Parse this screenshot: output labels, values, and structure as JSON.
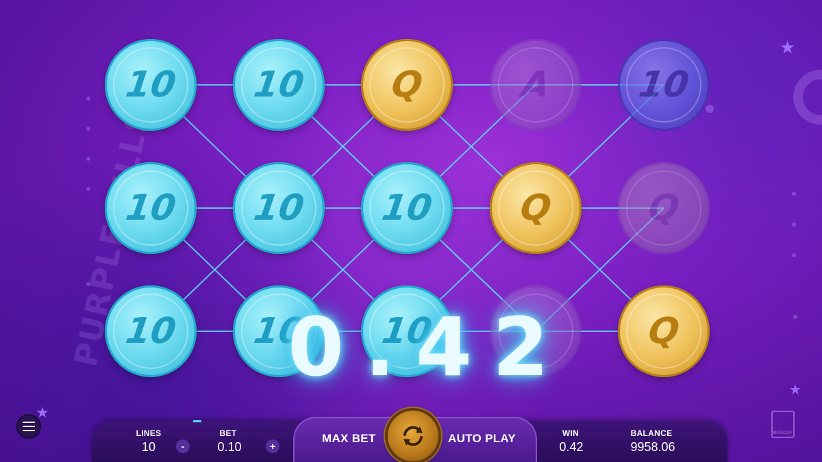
{
  "game": {
    "side_title": "PURPLE PILLS",
    "win_amount": "0.42"
  },
  "reels": [
    {
      "symbol": "10",
      "style": "cyan"
    },
    {
      "symbol": "10",
      "style": "cyan"
    },
    {
      "symbol": "10",
      "style": "cyan"
    },
    {
      "symbol": "10",
      "style": "cyan"
    },
    {
      "symbol": "10",
      "style": "cyan"
    },
    {
      "symbol": "10",
      "style": "cyan"
    },
    {
      "symbol": "Q",
      "style": "gold"
    },
    {
      "symbol": "10",
      "style": "cyan"
    },
    {
      "symbol": "10",
      "style": "cyan"
    },
    {
      "symbol": "A",
      "style": "dim"
    },
    {
      "symbol": "Q",
      "style": "gold"
    },
    {
      "symbol": "",
      "style": "dim"
    },
    {
      "symbol": "10",
      "style": "blue"
    },
    {
      "symbol": "Q",
      "style": "dim-gold"
    },
    {
      "symbol": "Q",
      "style": "gold"
    }
  ],
  "controls": {
    "menu_icon": "hamburger-menu-icon",
    "lines_label": "LINES",
    "lines_value": "10",
    "lines_minus": "-",
    "bet_label": "BET",
    "bet_value": "0.10",
    "bet_plus": "+",
    "max_bet_label": "MAX BET",
    "spin_icon": "refresh-spin-icon",
    "auto_play_label": "AUTO PLAY",
    "win_label": "WIN",
    "win_value": "0.42",
    "balance_label": "BALANCE",
    "balance_value": "9958.06",
    "logo_text": "MASCOT"
  },
  "colors": {
    "background": "#7a1fc2",
    "payline": "#5fd6f5",
    "coin_cyan": "#6fdcf0",
    "coin_gold": "#efc25a",
    "win_glow": "#49c9f2"
  }
}
